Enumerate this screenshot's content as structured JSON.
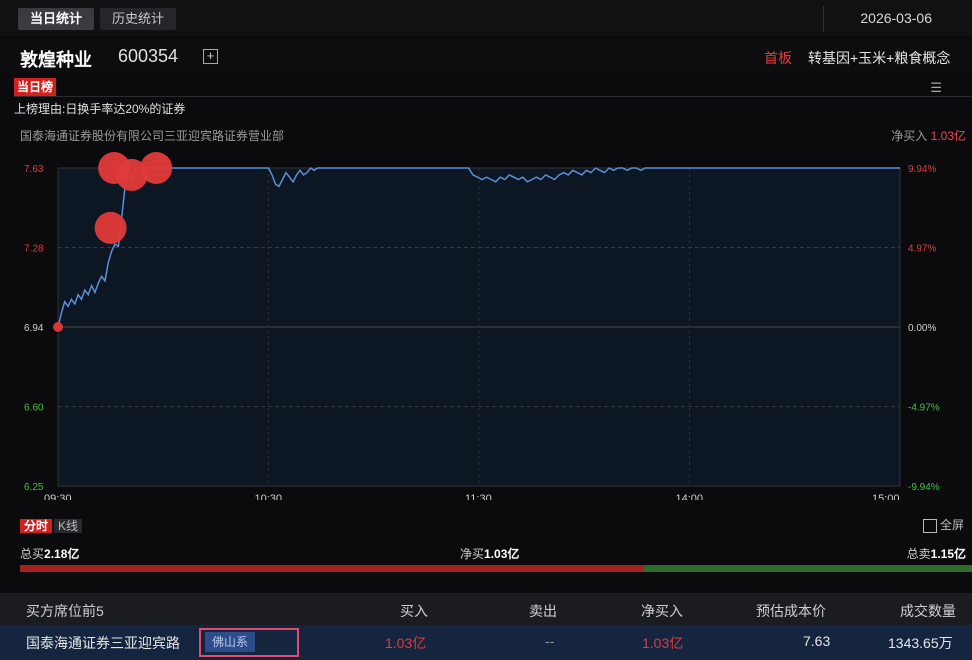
{
  "tabs": [
    {
      "label": "当日统计",
      "active": true
    },
    {
      "label": "历史统计",
      "active": false
    }
  ],
  "date": "2026-03-06",
  "stock": {
    "name": "敦煌种业",
    "code": "600354",
    "add_symbol": "+",
    "first_board": "首板",
    "concept": "转基因+玉米+粮食概念"
  },
  "list_badge": "当日榜",
  "reason": "上榜理由:日换手率达20%的证券",
  "broker_name": "国泰海通证券股份有限公司三亚迎宾路证券营业部",
  "net_buy": {
    "label": "净买入",
    "value": "1.03亿"
  },
  "chart_data": {
    "type": "line",
    "x_ticks": [
      "09:30",
      "10:30",
      "11:30",
      "14:00",
      "15:00"
    ],
    "y_ticks_left": [
      "7.63",
      "7.28",
      "6.94",
      "6.60",
      "6.25"
    ],
    "y_ticks_right": [
      "9.94%",
      "4.97%",
      "0.00%",
      "-4.97%",
      "-9.94%"
    ],
    "ylim": [
      6.25,
      7.63
    ],
    "prev_close": 6.94,
    "series": [
      {
        "values": [
          6.94,
          7.02,
          7.05,
          7.03,
          7.06,
          7.04,
          7.08,
          7.06,
          7.1,
          7.08,
          7.12,
          7.09,
          7.13,
          7.15,
          7.14,
          7.22,
          7.28,
          7.3,
          7.3,
          7.42,
          7.55,
          7.63,
          7.6,
          7.63,
          7.63,
          7.63,
          7.63,
          7.63,
          7.63,
          7.63,
          7.63,
          7.63,
          7.63,
          7.63,
          7.63,
          7.63,
          7.63,
          7.63,
          7.63,
          7.63,
          7.63,
          7.63,
          7.63,
          7.63,
          7.63,
          7.63,
          7.63,
          7.63,
          7.63,
          7.63,
          7.63,
          7.63,
          7.63,
          7.63,
          7.63,
          7.63,
          7.63,
          7.63,
          7.63,
          7.63,
          7.63,
          7.63,
          7.63,
          7.63,
          7.63,
          7.63,
          7.63,
          7.63,
          7.63,
          7.63,
          7.63,
          7.63,
          7.63,
          7.63,
          7.63,
          7.63,
          7.63,
          7.63,
          7.63,
          7.63,
          7.63,
          7.63,
          7.63,
          7.63,
          7.63,
          7.63,
          7.63,
          7.63,
          7.63,
          7.63,
          7.63,
          7.63,
          7.63,
          7.63,
          7.63,
          7.63,
          7.63,
          7.63,
          7.63,
          7.63,
          7.63,
          7.63,
          7.63,
          7.63,
          7.63,
          7.63,
          7.63,
          7.63,
          7.63,
          7.63,
          7.63,
          7.63,
          7.63,
          7.63,
          7.63,
          7.63,
          7.63,
          7.63,
          7.63,
          7.63,
          7.63,
          7.63,
          7.63,
          7.63,
          7.63,
          7.63,
          7.63,
          7.63,
          7.63,
          7.63,
          7.63,
          7.63,
          7.63,
          7.63,
          7.63,
          7.63,
          7.63,
          7.63,
          7.63,
          7.63,
          7.63,
          7.63,
          7.63,
          7.63,
          7.63,
          7.63,
          7.63,
          7.63,
          7.63,
          7.63,
          7.63,
          7.63,
          7.63,
          7.63,
          7.63,
          7.63,
          7.63,
          7.63,
          7.63,
          7.63,
          7.63,
          7.63,
          7.63,
          7.63,
          7.63,
          7.63,
          7.63,
          7.63,
          7.63,
          7.63,
          7.63,
          7.63,
          7.63,
          7.63,
          7.63,
          7.63,
          7.63,
          7.63,
          7.63,
          7.63,
          7.63,
          7.63,
          7.63,
          7.63,
          7.63,
          7.63,
          7.63,
          7.63,
          7.63,
          7.63,
          7.63,
          7.63,
          7.63,
          7.63,
          7.63,
          7.63,
          7.63,
          7.63,
          7.63,
          7.63,
          7.63,
          7.63,
          7.63,
          7.63,
          7.63,
          7.63,
          7.63,
          7.63,
          7.63,
          7.63,
          7.63,
          7.63,
          7.63,
          7.63,
          7.63,
          7.63,
          7.63,
          7.63,
          7.63,
          7.63,
          7.63,
          7.63,
          7.63,
          7.63,
          7.63,
          7.63,
          7.63,
          7.63,
          7.63
        ]
      }
    ],
    "segments": [
      {
        "from_min": 0,
        "to_min": 22,
        "values": [
          6.94,
          7.0,
          7.05,
          7.03,
          7.06,
          7.04,
          7.08,
          7.06,
          7.1,
          7.08,
          7.12,
          7.09,
          7.13,
          7.16,
          7.14,
          7.22,
          7.27,
          7.3,
          7.29,
          7.42,
          7.55,
          7.63,
          7.58,
          7.63
        ]
      },
      {
        "from_min": 22,
        "to_min": 60,
        "values": [
          7.63
        ]
      },
      {
        "from_min": 60,
        "to_min": 75,
        "values": [
          7.63,
          7.6,
          7.56,
          7.55,
          7.58,
          7.61,
          7.59,
          7.57,
          7.6,
          7.62,
          7.6,
          7.61,
          7.63,
          7.62,
          7.63,
          7.63
        ]
      },
      {
        "from_min": 75,
        "to_min": 117,
        "values": [
          7.63
        ]
      },
      {
        "from_min": 117,
        "to_min": 170,
        "values": [
          7.63,
          7.6,
          7.59,
          7.58,
          7.59,
          7.58,
          7.57,
          7.59,
          7.58,
          7.6,
          7.59,
          7.58,
          7.59,
          7.57,
          7.58,
          7.59,
          7.58,
          7.6,
          7.59,
          7.58,
          7.6,
          7.61,
          7.6,
          7.62,
          7.61,
          7.6,
          7.62,
          7.61,
          7.63,
          7.62,
          7.61,
          7.63,
          7.62,
          7.63,
          7.63,
          7.62,
          7.63,
          7.63,
          7.62,
          7.63,
          7.63,
          7.63
        ]
      },
      {
        "from_min": 170,
        "to_min": 240,
        "values": [
          7.63
        ]
      }
    ],
    "markers": [
      {
        "minute": 0,
        "value": 6.94,
        "size": "small"
      },
      {
        "minute": 15,
        "value": 7.37,
        "size": "large"
      },
      {
        "minute": 16,
        "value": 7.63,
        "size": "large"
      },
      {
        "minute": 21,
        "value": 7.6,
        "size": "large"
      },
      {
        "minute": 28,
        "value": 7.63,
        "size": "large"
      }
    ]
  },
  "chart_modes": [
    {
      "label": "分时",
      "active": true
    },
    {
      "label": "K线",
      "active": false
    }
  ],
  "fullscreen_label": "全屏",
  "totals": {
    "total_buy_label": "总买",
    "total_buy": "2.18亿",
    "net_buy_label": "净买",
    "net_buy": "1.03亿",
    "total_sell_label": "总卖",
    "total_sell": "1.15亿",
    "buy_ratio": 0.655
  },
  "table": {
    "headers": [
      "买方席位前5",
      "买入",
      "卖出",
      "净买入",
      "预估成本价",
      "成交数量"
    ],
    "rows": [
      {
        "seat": "国泰海通证券三亚迎宾路",
        "tag": "佛山系",
        "buy": "1.03亿",
        "sell": "--",
        "net": "1.03亿",
        "cost": "7.63",
        "volume": "1343.65万"
      }
    ]
  },
  "colors": {
    "red": "#e03b3b",
    "green": "#3ec23e",
    "line": "#5b8fd6",
    "bg": "#0b0b0d"
  }
}
